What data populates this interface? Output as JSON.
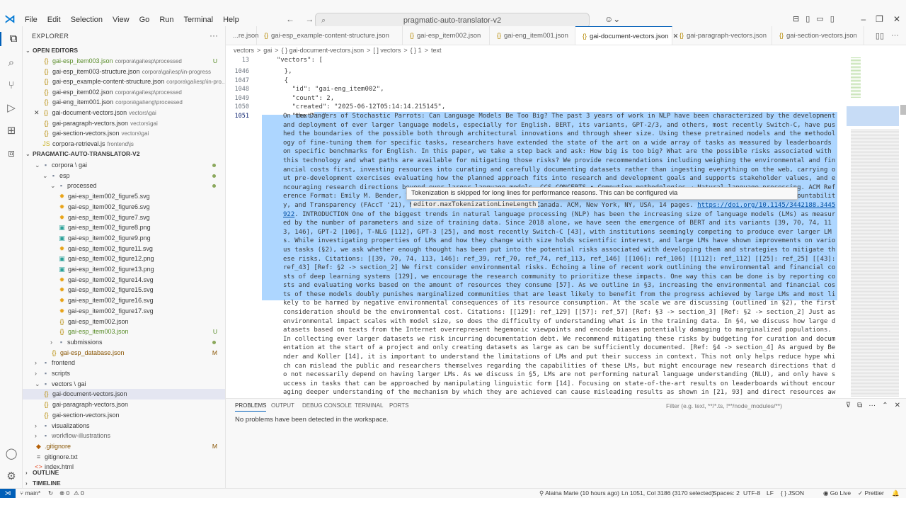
{
  "titlebar": {
    "menu": [
      "File",
      "Edit",
      "Selection",
      "View",
      "Go",
      "Run",
      "Terminal",
      "Help"
    ],
    "search": "pragmatic-auto-translator-v2",
    "back": "←",
    "forward": "→"
  },
  "explorer": {
    "title": "EXPLORER",
    "open_editors_title": "OPEN EDITORS",
    "open_editors": [
      {
        "name": "gai-esp_item003.json",
        "path": "corpora\\gai\\esp\\processed",
        "badge": "U"
      },
      {
        "name": "gai-esp_item003-structure.json",
        "path": "corpora\\gai\\esp\\in-progress",
        "badge": ""
      },
      {
        "name": "gai-esp_example-content-structure.json",
        "path": "corpora\\gai\\esp\\in-pro...",
        "badge": ""
      },
      {
        "name": "gai-esp_item002.json",
        "path": "corpora\\gai\\esp\\processed",
        "badge": ""
      },
      {
        "name": "gai-eng_item001.json",
        "path": "corpora\\gai\\eng\\processed",
        "badge": ""
      },
      {
        "name": "gai-document-vectors.json",
        "path": "vectors\\gai",
        "badge": ""
      },
      {
        "name": "gai-paragraph-vectors.json",
        "path": "vectors\\gai",
        "badge": ""
      },
      {
        "name": "gai-section-vectors.json",
        "path": "vectors\\gai",
        "badge": ""
      },
      {
        "name": "corpora-retrieval.js",
        "path": "frontend\\js",
        "badge": ""
      }
    ],
    "project_title": "PRAGMATIC-AUTO-TRANSLATOR-V2",
    "tree": [
      {
        "name": "corpora \\ gai",
        "type": "folder",
        "indent": 1,
        "open": true,
        "dot": true
      },
      {
        "name": "esp",
        "type": "folder",
        "indent": 2,
        "open": true,
        "dot": true
      },
      {
        "name": "processed",
        "type": "folder",
        "indent": 3,
        "open": true,
        "dot": true
      },
      {
        "name": "gai-esp_item002_figure5.svg",
        "type": "svg",
        "indent": 4
      },
      {
        "name": "gai-esp_item002_figure6.svg",
        "type": "svg",
        "indent": 4
      },
      {
        "name": "gai-esp_item002_figure7.svg",
        "type": "svg",
        "indent": 4
      },
      {
        "name": "gai-esp_item002_figure8.png",
        "type": "png",
        "indent": 4
      },
      {
        "name": "gai-esp_item002_figure9.png",
        "type": "png",
        "indent": 4
      },
      {
        "name": "gai-esp_item002_figure11.svg",
        "type": "svg",
        "indent": 4
      },
      {
        "name": "gai-esp_item002_figure12.png",
        "type": "png",
        "indent": 4
      },
      {
        "name": "gai-esp_item002_figure13.png",
        "type": "png",
        "indent": 4
      },
      {
        "name": "gai-esp_item002_figure14.svg",
        "type": "svg",
        "indent": 4
      },
      {
        "name": "gai-esp_item002_figure15.svg",
        "type": "svg",
        "indent": 4
      },
      {
        "name": "gai-esp_item002_figure16.svg",
        "type": "svg",
        "indent": 4
      },
      {
        "name": "gai-esp_item002_figure17.svg",
        "type": "svg",
        "indent": 4
      },
      {
        "name": "gai-esp_item002.json",
        "type": "json",
        "indent": 4
      },
      {
        "name": "gai-esp_item003.json",
        "type": "json",
        "indent": 4,
        "badge": "U",
        "green": true
      },
      {
        "name": "submissions",
        "type": "folder",
        "indent": 3,
        "open": false,
        "dot": true
      },
      {
        "name": "gai-esp_database.json",
        "type": "json",
        "indent": 3,
        "badge": "M",
        "mod": true
      },
      {
        "name": "frontend",
        "type": "folder",
        "indent": 1,
        "open": false
      },
      {
        "name": "scripts",
        "type": "folder",
        "indent": 1,
        "open": false
      },
      {
        "name": "vectors \\ gai",
        "type": "folder",
        "indent": 1,
        "open": true
      },
      {
        "name": "gai-document-vectors.json",
        "type": "json",
        "indent": 2,
        "selected": true
      },
      {
        "name": "gai-paragraph-vectors.json",
        "type": "json",
        "indent": 2
      },
      {
        "name": "gai-section-vectors.json",
        "type": "json",
        "indent": 2
      },
      {
        "name": "visualizations",
        "type": "folder",
        "indent": 1,
        "open": false
      },
      {
        "name": "workflow-illustrations",
        "type": "folder",
        "indent": 1,
        "open": false,
        "dim": true
      },
      {
        "name": ".gitignore",
        "type": "git",
        "indent": 1,
        "badge": "M",
        "mod": true
      },
      {
        "name": "gitignore.txt",
        "type": "txt",
        "indent": 1
      },
      {
        "name": "index.html",
        "type": "html",
        "indent": 1
      }
    ],
    "outline": "OUTLINE",
    "timeline": "TIMELINE"
  },
  "tabs": [
    {
      "label": "...re.json",
      "active": false
    },
    {
      "label": "gai-esp_example-content-structure.json",
      "active": false
    },
    {
      "label": "gai-esp_item002.json",
      "active": false
    },
    {
      "label": "gai-eng_item001.json",
      "active": false
    },
    {
      "label": "gai-document-vectors.json",
      "active": true
    },
    {
      "label": "gai-paragraph-vectors.json",
      "active": false
    },
    {
      "label": "gai-section-vectors.json",
      "active": false
    }
  ],
  "breadcrumb": [
    "vectors",
    ">",
    "gai",
    ">",
    "{ } gai-document-vectors.json",
    ">",
    "[ ] vectors",
    ">",
    "{ } 1",
    ">",
    "text"
  ],
  "editor": {
    "sticky": "\"vectors\": [",
    "lines": [
      {
        "num": "13",
        "text": "  \"vectors\": ["
      },
      {
        "num": "1046",
        "text": "    },"
      },
      {
        "num": "1047",
        "text": "    {"
      },
      {
        "num": "1048",
        "text": "      \"id\": \"gai-eng_item002\","
      },
      {
        "num": "1049",
        "text": "      \"count\": 2,"
      },
      {
        "num": "1050",
        "text": "      \"created\": \"2025-06-12T05:14:14.215145\","
      },
      {
        "num": "1051",
        "text": "      \"text\": \""
      }
    ],
    "text_body": "On the Dangers of Stochastic Parrots: Can Language Models Be Too Big? The past 3 years of work in NLP have been characterized by the development and deployment of ever larger language models, especially for English. BERT, its variants, GPT-2/3, and others, most recently Switch-C, have pushed the boundaries of the possible both through architectural innovations and through sheer size. Using these pretrained models and the methodology of fine-tuning them for specific tasks, researchers have extended the state of the art on a wide array of tasks as measured by leaderboards on specific benchmarks for English. In this paper, we take a step back and ask: How big is too big? What are the possible risks associated with this technology and what paths are available for mitigating those risks? We provide recommendations including weighing the environmental and financial costs first, investing resources into curating and carefully documenting datasets rather than ingesting everything on the web, carrying out pre-development exercises evaluating how the planned approach fits into research and development goals and supports stakeholder values, and encouraging research directions beyond ever larger language models. CCS CONCEPTS • Computing methodologies → Natural language processing. ACM Reference Format: Emily M. Bender, Timnit Gebru, Angelina McMillan-Major, and Shmargaret Shmitchell. 2021. In Conference on Fairness, Accountability, and Transparency (FAccT '21), March 3–10, 2021, Virtual Event, Canada. ACM, New York, NY, USA, 14 pages. ",
    "link": "https://doi.org/10.1145/3442188.3445922",
    "text_body2": ". INTRODUCTION One of the biggest trends in natural language processing (NLP) has been the increasing size of language models (LMs) as measured by the number of parameters and size of training data. Since 2018 alone, we have seen the emergence of BERT and its variants [39, 70, 74, 113, 146], GPT-2 [106], T-NLG [112], GPT-3 [25], and most recently Switch-C [43], with institutions seemingly competing to produce ever larger LMs. While investigating properties of LMs and how they change with size holds scientific interest, and large LMs have shown improvements on various tasks (§2), we ask whether enough thought has been put into the potential risks associated with developing them and strategies to mitigate these risks. Citations: [[39, 70, 74, 113, 146]: ref_39, ref_70, ref_74, ref_113, ref_146] [[106]: ref_106] [[112]: ref_112] [[25]: ref_25] [[43]: ref_43] [Ref: §2 -> section_2] We first consider environmental risks. Echoing a line of recent work outlining the environmental and financial costs of deep learning systems [129], we encourage the research community to prioritize these impacts. One way this can be done is by reporting costs and evaluating works based on the amount of resources they consume [57]. As we outline in §3, increasing the environmental and financial costs of these models doubly punishes marginalized communities that are least likely to benefit from the progress achieved by large LMs and most likely to be harmed by negative environmental consequences of its resource consumption. At the scale we are discussing (outlined in §2), the first consideration should be the environmental cost. Citations: [[129]: ref_129] [[57]: ref_57] [Ref: §3 -> section_3] [Ref: §2 -> section_2] Just as environmental impact scales with model size, so does the difficulty of understanding what is in the training data. In §4, we discuss how large datasets based on texts from the Internet overrepresent hegemonic viewpoints and encode biases potentially damaging to marginalized populations. In collecting ever larger datasets we risk incurring documentation debt. We recommend mitigating these risks by budgeting for curation and documentation at the start of a project and only creating datasets as large as can be sufficiently documented. [Ref: §4 -> section_4] As argued by Bender and Koller [14], it is important to understand the limitations of LMs and put their success in context. This not only helps reduce hype which can mislead the public and researchers themselves regarding the capabilities of these LMs, but might encourage new research directions that do not necessarily depend on having larger LMs. As we discuss in §5, LMs are not performing natural language understanding (NLU), and only have success in tasks that can be approached by manipulating linguistic form [14]. Focusing on state-of-the-art results on leaderboards without encouraging deeper understanding of the mechanism by which they are achieved can cause misleading results as shown in [21, 93] and direct resources away from efforts that would facilitate long-term progress towards natural language",
    "tooltip_text": "Tokenization is skipped for long lines for performance reasons. This can be configured via",
    "tooltip_code": "editor.maxTokenizationLineLength",
    "tooltip_end": "."
  },
  "panel": {
    "tabs": [
      "PROBLEMS",
      "OUTPUT",
      "DEBUG CONSOLE",
      "TERMINAL",
      "PORTS"
    ],
    "filter_placeholder": "Filter (e.g. text, **/*.ts, !**/node_modules/**)",
    "message": "No problems have been detected in the workspace."
  },
  "status": {
    "branch": "main*",
    "sync": "↻",
    "errors": "⊗ 0",
    "warnings": "⚠ 0",
    "author": "Alaina Marie (10 hours ago)",
    "position": "Ln 1051, Col 3186 (3170 selected)",
    "spaces": "Spaces: 2",
    "encoding": "UTF-8",
    "eol": "LF",
    "language": "{ } JSON",
    "golive": "Go Live",
    "prettier": "✓ Prettier",
    "bell": "🔔"
  }
}
